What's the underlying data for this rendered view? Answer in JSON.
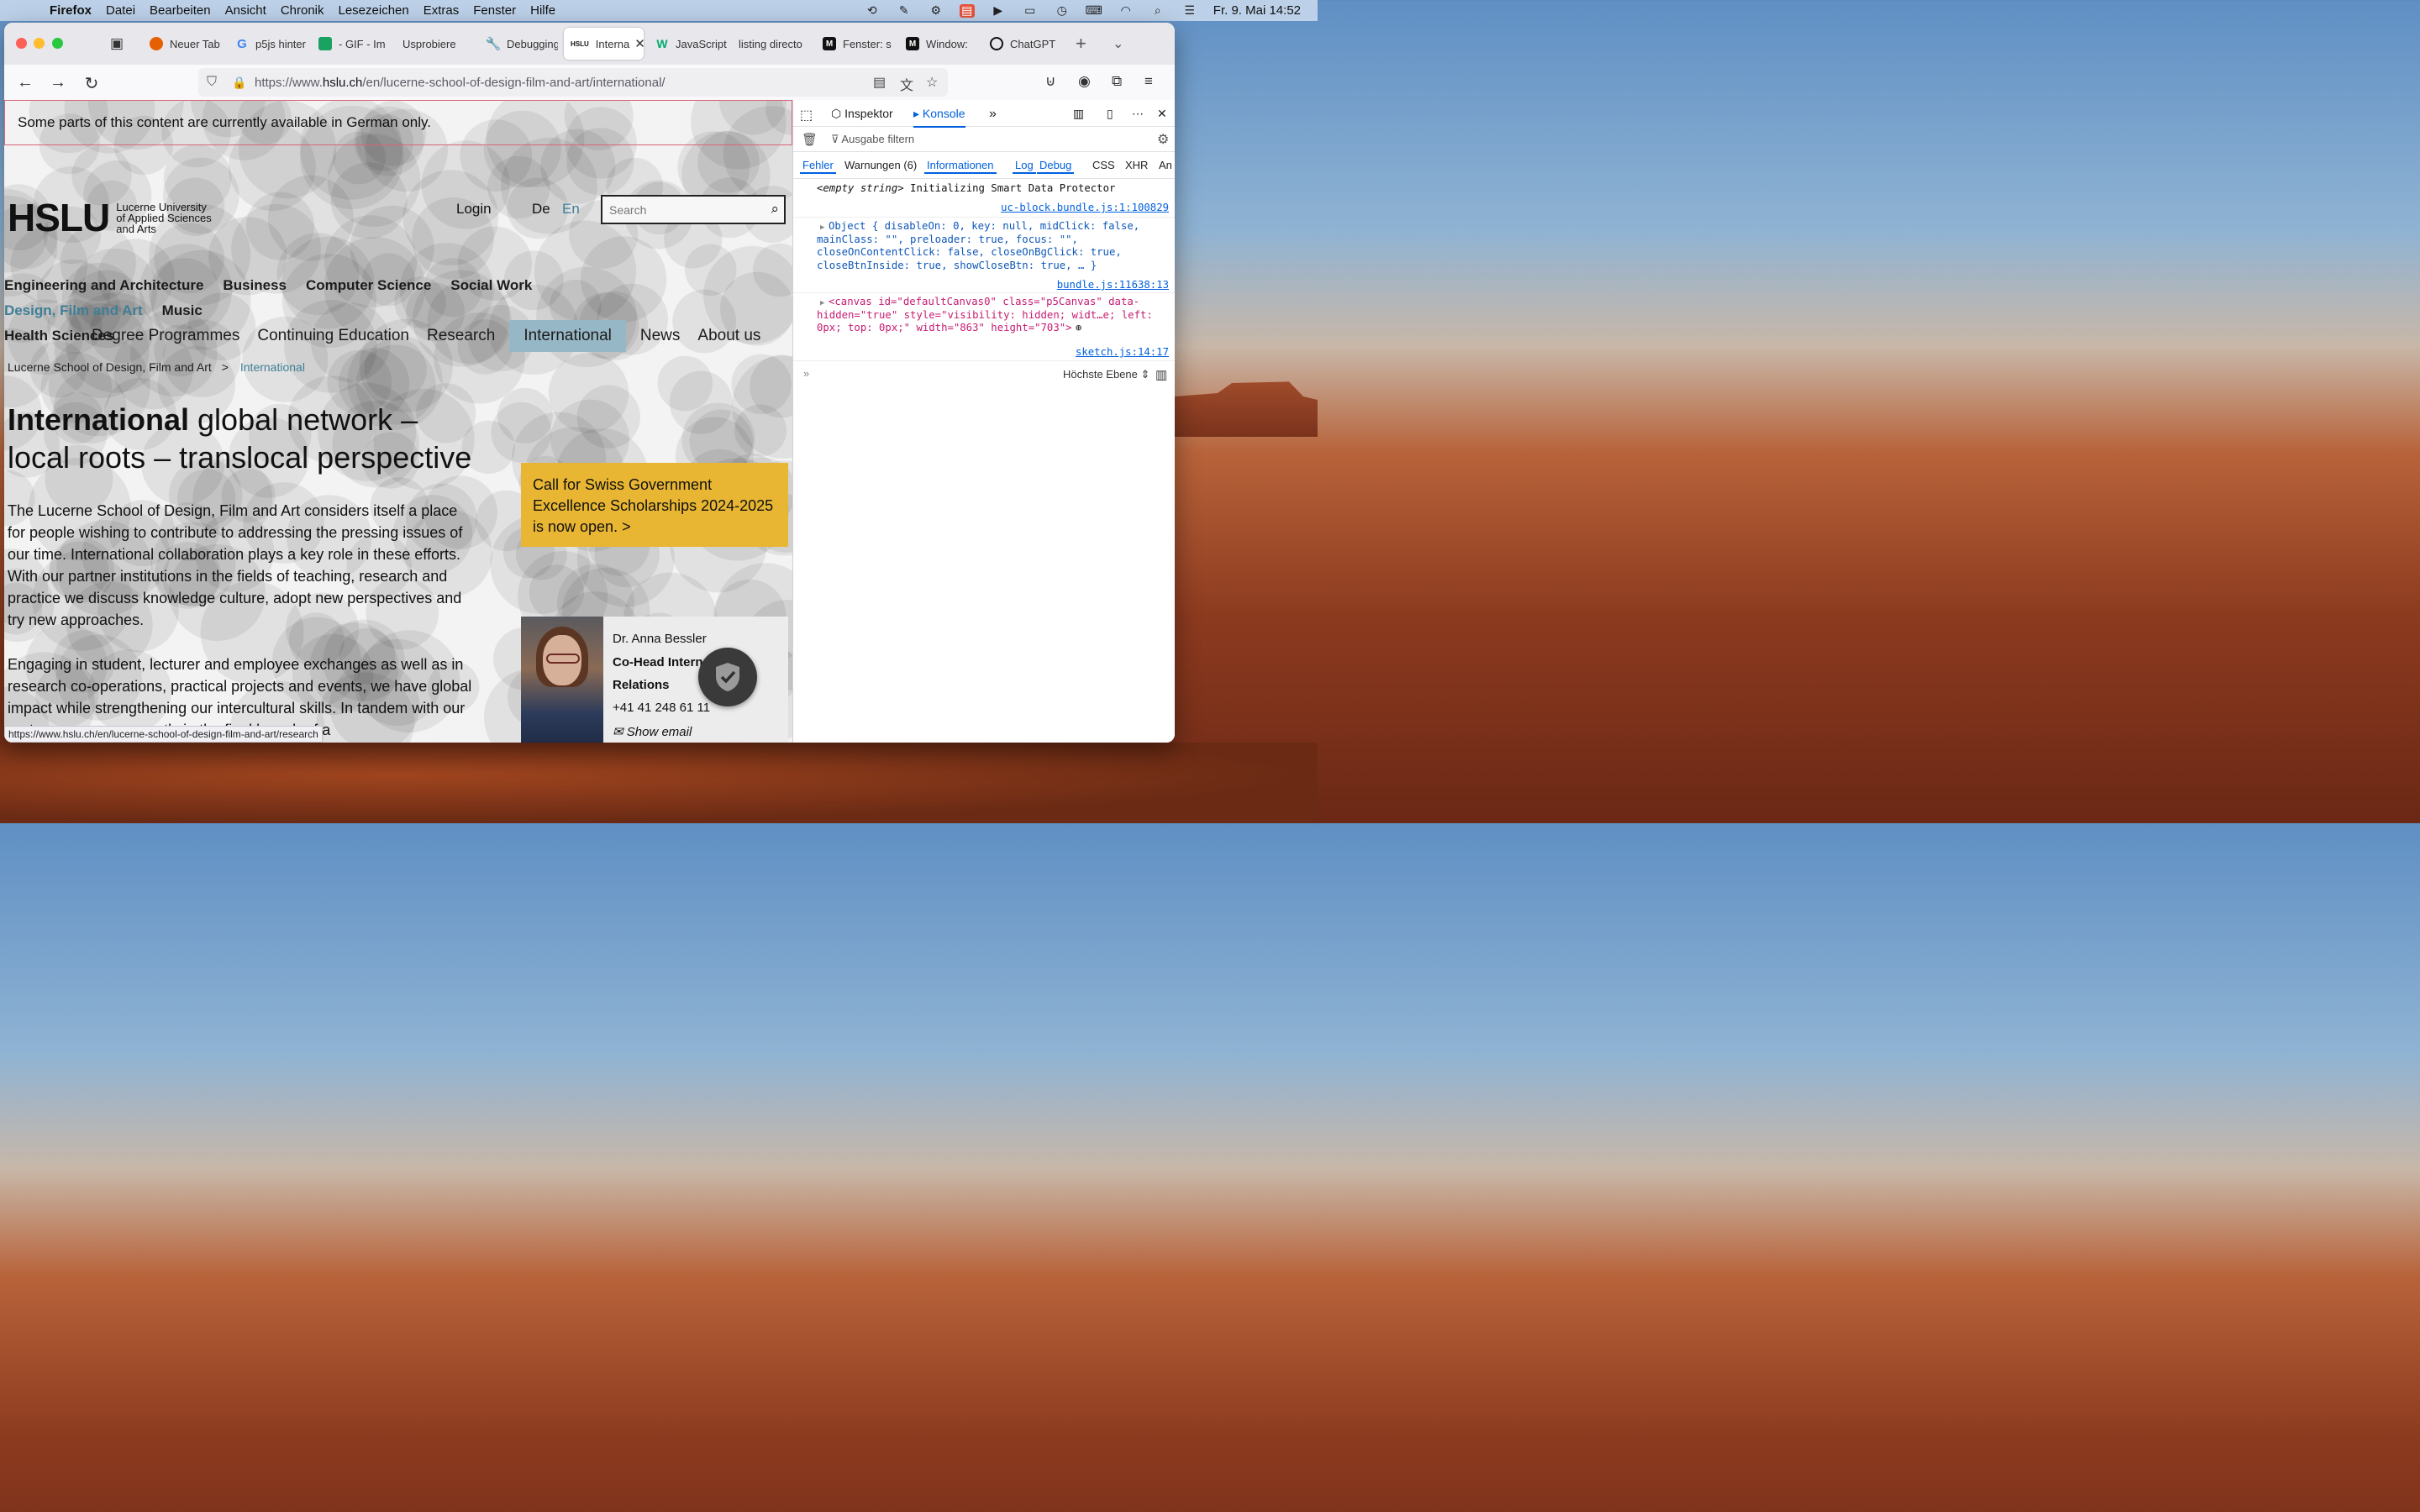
{
  "menubar": {
    "app": "Firefox",
    "items": [
      "Datei",
      "Bearbeiten",
      "Ansicht",
      "Chronik",
      "Lesezeichen",
      "Extras",
      "Fenster",
      "Hilfe"
    ],
    "clock": "Fr. 9. Mai  14:52"
  },
  "tabs": [
    {
      "label": "Neuer Tab",
      "fav": "firefox-icon",
      "color": "#e66000"
    },
    {
      "label": "p5js hinter",
      "fav": "google-icon",
      "color": "#4285f4"
    },
    {
      "label": "- GIF - Im",
      "fav": "gif-icon",
      "color": "#1aa260"
    },
    {
      "label": "Usprobiere",
      "fav": "",
      "color": ""
    },
    {
      "label": "Debugging",
      "fav": "wrench-icon",
      "color": "#333"
    },
    {
      "label": "Interna",
      "fav": "hslu-icon",
      "color": "#111"
    },
    {
      "label": "JavaScript",
      "fav": "w3-icon",
      "color": "#04aa6d"
    },
    {
      "label": "listing directo",
      "fav": "",
      "color": ""
    },
    {
      "label": "Fenster: s",
      "fav": "m-icon",
      "color": "#111"
    },
    {
      "label": "Window:",
      "fav": "m-icon",
      "color": "#111"
    },
    {
      "label": "ChatGPT",
      "fav": "chatgpt-icon",
      "color": "#111"
    }
  ],
  "url": {
    "prefix": "https://www.",
    "host": "hslu.ch",
    "path": "/en/lucerne-school-of-design-film-and-art/international/"
  },
  "page": {
    "banner": "Some parts of this content are currently available in German only.",
    "logo_big": "HSLU",
    "logo_line1": "Lucerne University",
    "logo_line2": "of Applied Sciences",
    "logo_line3": "and Arts",
    "login": "Login",
    "lang_de": "De",
    "lang_en": "En",
    "search_placeholder": "Search",
    "faculties": [
      "Engineering and Architecture",
      "Business",
      "Computer Science",
      "Social Work",
      "Design, Film and Art",
      "Music",
      "Health Sciences"
    ],
    "subnav": [
      "Degree Programmes",
      "Continuing Education",
      "Research",
      "International",
      "News",
      "About us"
    ],
    "crumb_parent": "Lucerne School of Design, Film and Art",
    "crumb_sep": ">",
    "crumb_current": "International",
    "h1_bold": "International",
    "h1_rest": " global network – local roots – translocal perspective",
    "p1": "The Lucerne School of Design, Film and Art considers itself a place for people wishing to contribute to addressing the pressing issues of our time. International collaboration plays a key role in these efforts. With our partner institutions in the fields of teaching, research and practice we discuss knowledge culture, adopt new perspectives and try new approaches.",
    "p2": "Engaging in student, lecturer and employee exchanges as well as in research co-operations, practical projects and events, we have global impact while strengthening our intercultural skills. In tandem with our partners, we are currently in the final launch of a",
    "cta": "Call for Swiss Government Excellence Scholarships 2024-2025 is now open.  >",
    "contact_name": "Dr. Anna Bessler",
    "contact_role1": "Co-Head Interna",
    "contact_role2": "Relations",
    "contact_phone": "+41 41 248 61 11",
    "contact_email": "Show email",
    "status_url": "https://www.hslu.ch/en/lucerne-school-of-design-film-and-art/research"
  },
  "devtools": {
    "inspector": "Inspektor",
    "console": "Konsole",
    "filter_placeholder": "Ausgabe filtern",
    "levels": [
      "Fehler",
      "Warnungen (6)",
      "Informationen",
      "Log",
      "Debug",
      "CSS",
      "XHR",
      "An"
    ],
    "log1_a": "<empty string>",
    "log1_b": " Initializing Smart Data Protector",
    "log1_src": "uc-block.bundle.js:1:100829",
    "log2_l1": "Object { disableOn: 0, key: null, midClick: false,",
    "log2_l2": "mainClass: \"\", preloader: true, focus: \"\",",
    "log2_l3": "closeOnContentClick: false, closeOnBgClick: true,",
    "log2_l4": "closeBtnInside: true, showCloseBtn: true, … }",
    "log2_src": "bundle.js:11638:13",
    "log3_l1": "<canvas id=\"defaultCanvas0\" class=\"p5Canvas\" data-",
    "log3_l2": "hidden=\"true\" style=\"visibility: hidden; widt…e; left:",
    "log3_l3": "0px; top: 0px;\" width=\"863\" height=\"703\">",
    "log3_src": "sketch.js:14:17",
    "context": "Höchste Ebene"
  }
}
